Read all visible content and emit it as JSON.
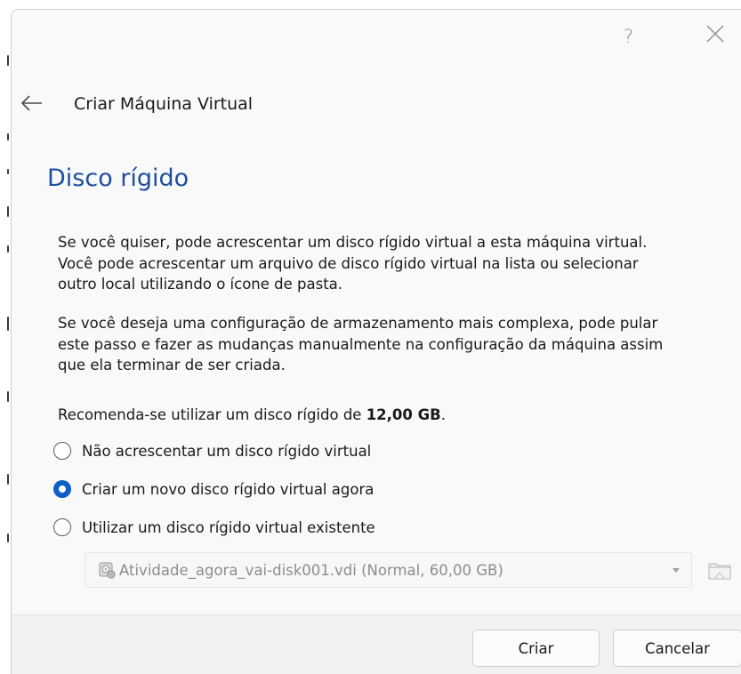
{
  "window": {
    "help_label": "?",
    "header_title": "Criar Máquina Virtual"
  },
  "page": {
    "title": "Disco rígido",
    "paragraph1_line1": "Se você quiser, pode acrescentar um disco rígido virtual a esta máquina virtual.",
    "paragraph1_line2": "Você pode acrescentar um arquivo de disco rígido virtual na lista ou selecionar",
    "paragraph1_line3": "outro local utilizando o ícone de pasta.",
    "paragraph2_line1": "Se você deseja uma configuração de armazenamento mais complexa, pode pular",
    "paragraph2_line2": "este passo e fazer as mudanças manualmente na configuração da máquina assim",
    "paragraph2_line3": "que ela terminar de ser criada.",
    "recommend_prefix": "Recomenda-se utilizar um disco rígido de ",
    "recommend_size": "12,00 GB",
    "recommend_suffix": "."
  },
  "options": [
    {
      "label": "Não acrescentar um disco rígido virtual",
      "checked": false
    },
    {
      "label": "Criar um novo disco rígido virtual agora",
      "checked": true
    },
    {
      "label": "Utilizar um disco rígido virtual existente",
      "checked": false
    }
  ],
  "disk_select": {
    "value": "Atividade_agora_vai-disk001.vdi (Normal, 60,00 GB)",
    "icon": "hard-disk-icon"
  },
  "buttons": {
    "create": "Criar",
    "cancel": "Cancelar"
  },
  "colors": {
    "title_blue": "#1f4e9f",
    "radio_checked": "#0b5fc6"
  }
}
